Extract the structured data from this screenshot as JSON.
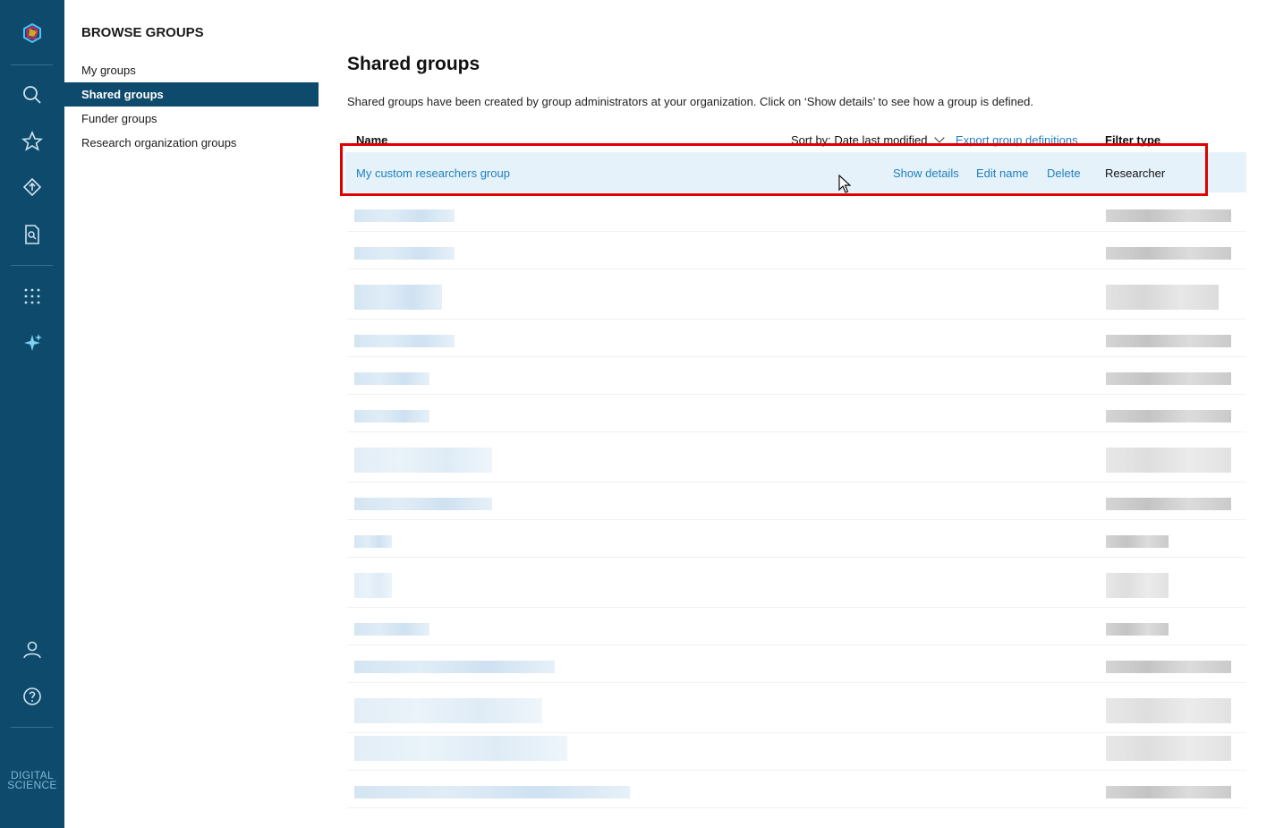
{
  "sidebar": {
    "brand": "DIGITAL SCIENCE",
    "icons": [
      "logo-icon",
      "search-icon",
      "star-icon",
      "upload-icon",
      "document-search-icon",
      "apps-grid-icon",
      "sparkle-icon",
      "user-icon",
      "help-icon"
    ]
  },
  "panel": {
    "title": "BROWSE GROUPS",
    "items": [
      {
        "label": "My groups"
      },
      {
        "label": "Shared groups"
      },
      {
        "label": "Funder groups"
      },
      {
        "label": "Research organization groups"
      }
    ],
    "active_index": 1
  },
  "main": {
    "title": "Shared groups",
    "description": "Shared groups have been created by group administrators at your organization. Click on ‘Show details’ to see how a group is defined.",
    "columns": {
      "name": "Name",
      "filter_type": "Filter type"
    },
    "sort_label": "Sort by:",
    "sort_value": "Date last modified",
    "export_label": "Export group definitions",
    "row": {
      "name": "My custom researchers group",
      "show_details": "Show details",
      "edit_name": "Edit name",
      "delete": "Delete",
      "filter_type": "Researcher"
    }
  },
  "colors": {
    "rail": "#0e4a6b",
    "link": "#1f7fc0",
    "highlight": "#e6f2fa",
    "annotation": "#e00000"
  }
}
